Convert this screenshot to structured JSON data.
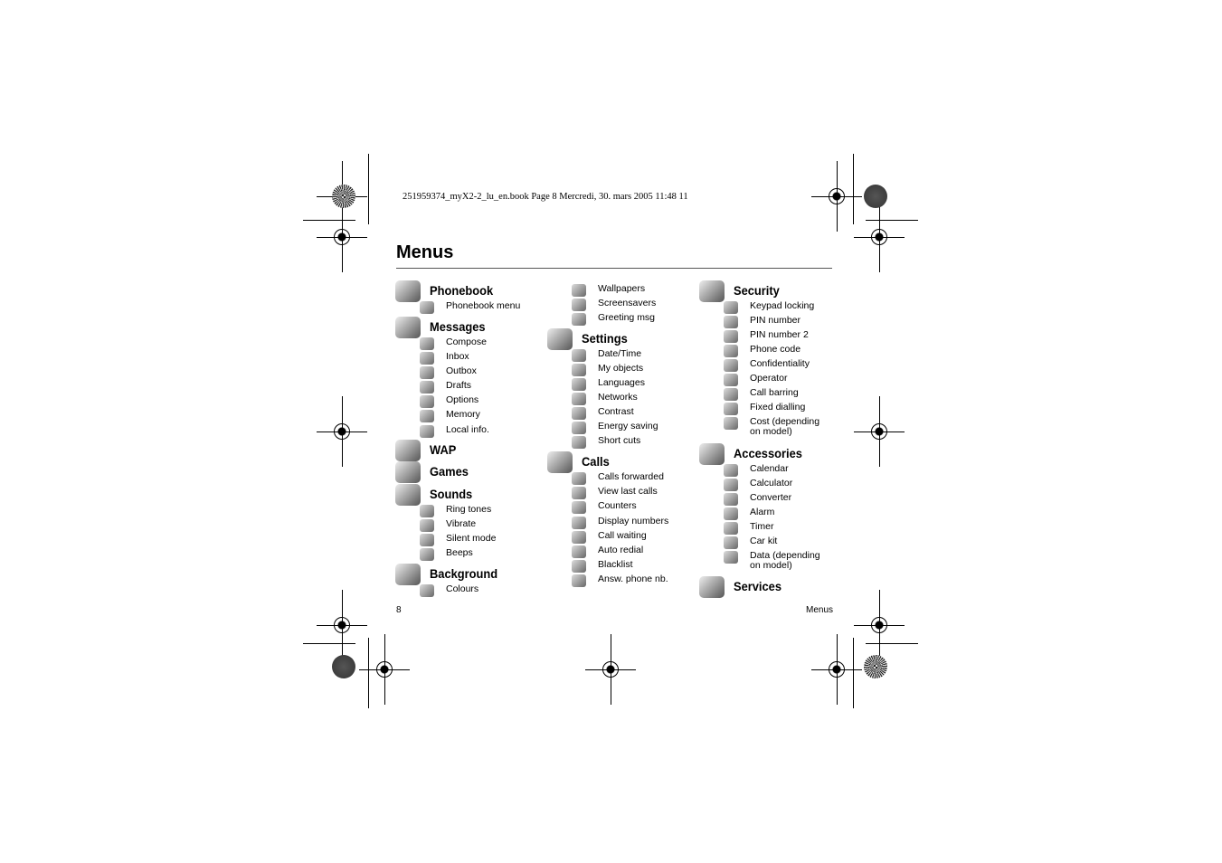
{
  "header": "251959374_myX2-2_lu_en.book  Page 8  Mercredi, 30. mars 2005  11:48 11",
  "title": "Menus",
  "footer": {
    "page": "8",
    "section": "Menus"
  },
  "columns": [
    {
      "sections": [
        {
          "label": "Phonebook",
          "items": [
            "Phonebook menu"
          ]
        },
        {
          "label": "Messages",
          "items": [
            "Compose",
            "Inbox",
            "Outbox",
            "Drafts",
            "Options",
            "Memory",
            "Local info."
          ]
        },
        {
          "label": "WAP",
          "items": []
        },
        {
          "label": "Games",
          "items": []
        },
        {
          "label": "Sounds",
          "items": [
            "Ring tones",
            "Vibrate",
            "Silent mode",
            "Beeps"
          ]
        },
        {
          "label": "Background",
          "items": [
            "Colours"
          ]
        }
      ]
    },
    {
      "pre_items": [
        "Wallpapers",
        "Screensavers",
        "Greeting msg"
      ],
      "sections": [
        {
          "label": "Settings",
          "items": [
            "Date/Time",
            "My objects",
            "Languages",
            "Networks",
            "Contrast",
            "Energy saving",
            "Short cuts"
          ]
        },
        {
          "label": "Calls",
          "items": [
            "Calls forwarded",
            "View last calls",
            "Counters",
            "Display numbers",
            "Call waiting",
            "Auto redial",
            "Blacklist",
            "Answ. phone nb."
          ]
        }
      ]
    },
    {
      "sections": [
        {
          "label": "Security",
          "items": [
            "Keypad locking",
            "PIN number",
            "PIN number 2",
            "Phone code",
            "Confidentiality",
            "Operator",
            "Call barring",
            "Fixed dialling",
            "Cost (depending on model)"
          ]
        },
        {
          "label": "Accessories",
          "items": [
            "Calendar",
            "Calculator",
            "Converter",
            "Alarm",
            "Timer",
            "Car kit",
            "Data (depending on model)"
          ]
        },
        {
          "label": "Services",
          "items": []
        }
      ]
    }
  ]
}
